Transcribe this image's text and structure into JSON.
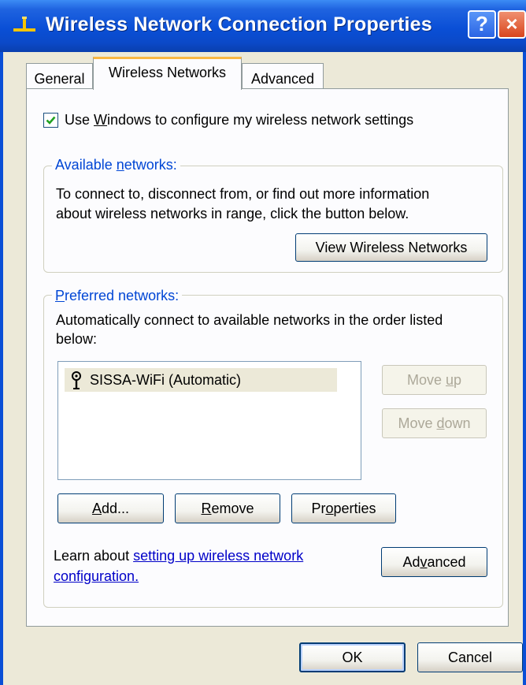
{
  "window": {
    "title": "Wireless Network Connection Properties",
    "help_label": "?",
    "close_label": "×"
  },
  "tabs": [
    {
      "label": "General"
    },
    {
      "label": "Wireless Networks",
      "selected": true
    },
    {
      "label": "Advanced"
    }
  ],
  "use_windows": {
    "checked": true,
    "label_pre": "Use ",
    "label_underline": "W",
    "label_post": "indows to configure my wireless network settings"
  },
  "available": {
    "legend_pre": "Available ",
    "legend_underline": "n",
    "legend_post": "etworks:",
    "desc_line1": "To connect to, disconnect from, or find out more information",
    "desc_line2": "about wireless networks in range, click the button below.",
    "view_button": "View Wireless Networks"
  },
  "preferred": {
    "legend_underline": "P",
    "legend_post": "referred networks:",
    "desc_line1": "Automatically connect to available networks in the order listed",
    "desc_line2": "below:",
    "networks": [
      {
        "name": "SISSA-WiFi (Automatic)"
      }
    ],
    "move_up_pre": "Move ",
    "move_up_underline": "u",
    "move_up_post": "p",
    "move_down_pre": "Move ",
    "move_down_underline": "d",
    "move_down_post": "own",
    "add_underline": "A",
    "add_post": "dd...",
    "remove_underline": "R",
    "remove_post": "emove",
    "properties_pre": "Pr",
    "properties_underline": "o",
    "properties_post": "perties",
    "learn_text": "Learn about ",
    "learn_link_line1": "setting up wireless network",
    "learn_link_line2": "configuration.",
    "advanced_pre": "Ad",
    "advanced_underline": "v",
    "advanced_post": "anced"
  },
  "footer": {
    "ok": "OK",
    "cancel": "Cancel"
  }
}
